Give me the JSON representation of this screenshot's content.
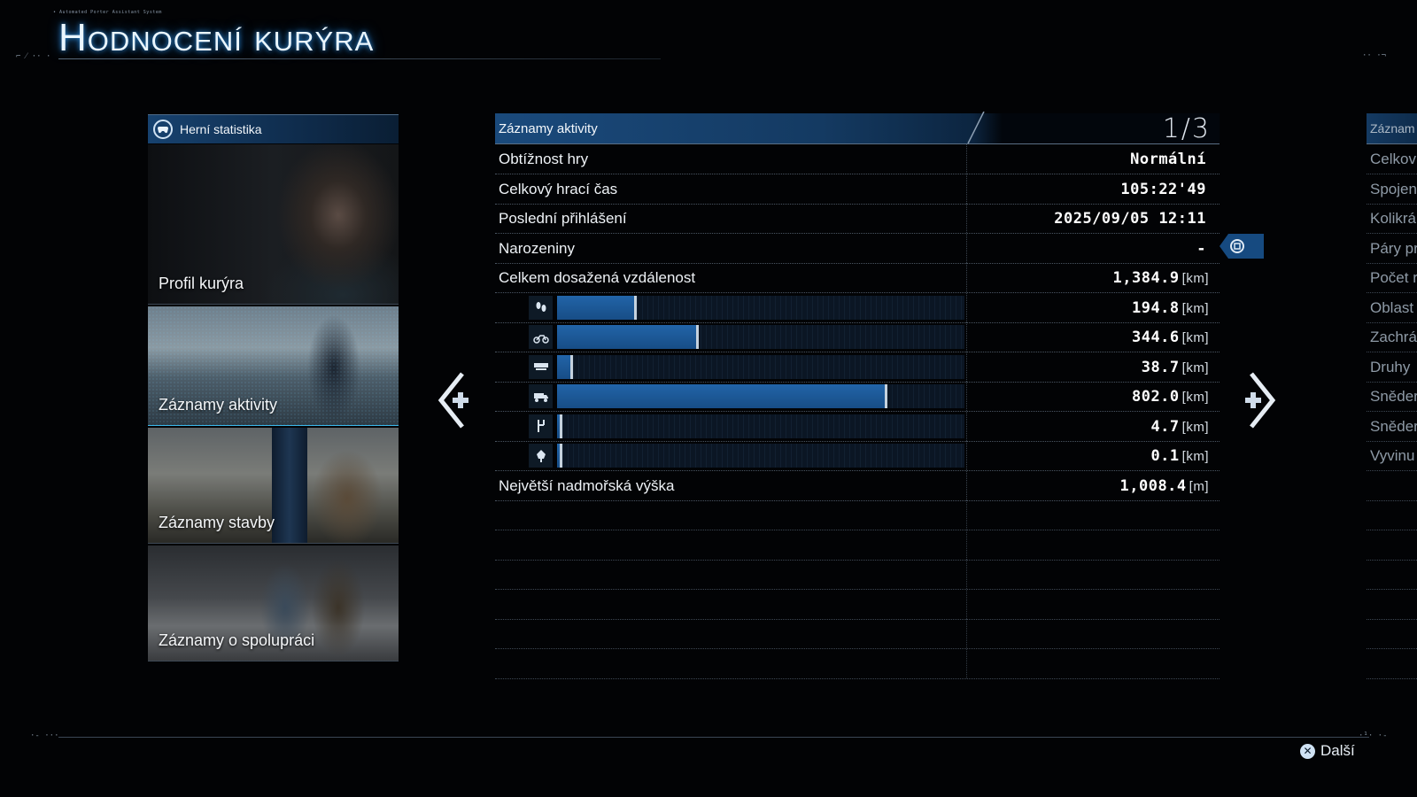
{
  "header": {
    "system_caption": "• Automated Porter Assistant System",
    "title": "Hodnocení kurýra"
  },
  "left_panel": {
    "header_label": "Herní statistika",
    "header_icon": "gamepad-icon",
    "cards": [
      {
        "label": "Profil kurýra",
        "selected": false
      },
      {
        "label": "Záznamy aktivity",
        "selected": true
      },
      {
        "label": "Záznamy stavby",
        "selected": false
      },
      {
        "label": "Záznamy o spolupráci",
        "selected": false
      }
    ]
  },
  "table": {
    "header_label": "Záznamy aktivity",
    "page_indicator": "1/3",
    "rows": [
      {
        "key": "Obtížnost hry",
        "value": "Normální",
        "unit": ""
      },
      {
        "key": "Celkový hrací čas",
        "value": "105:22'49",
        "unit": ""
      },
      {
        "key": "Poslední přihlášení",
        "value": "2025/09/05 12:11",
        "unit": ""
      },
      {
        "key": "Narozeniny",
        "value": "-",
        "unit": ""
      },
      {
        "key": "Celkem dosažená vzdálenost",
        "value": "1,384.9",
        "unit": "[km]"
      }
    ],
    "distance_breakdown": [
      {
        "icon": "footsteps-icon",
        "value": "194.8",
        "unit": "[km]",
        "fraction": 0.196
      },
      {
        "icon": "motorbike-icon",
        "value": "344.6",
        "unit": "[km]",
        "fraction": 0.348
      },
      {
        "icon": "floating-carrier-icon",
        "value": "38.7",
        "unit": "[km]",
        "fraction": 0.04
      },
      {
        "icon": "truck-icon",
        "value": "802.0",
        "unit": "[km]",
        "fraction": 0.81
      },
      {
        "icon": "zipline-icon",
        "value": "4.7",
        "unit": "[km]",
        "fraction": 0.008
      },
      {
        "icon": "jetpack-icon",
        "value": "0.1",
        "unit": "[km]",
        "fraction": 0.003
      }
    ],
    "last_row": {
      "key": "Největší nadmořská výška",
      "value": "1,008.4",
      "unit": "[m]"
    }
  },
  "right_peek": {
    "header_label": "Záznam",
    "rows": [
      "Celkov",
      "Spojen",
      "Kolikrá",
      "Páry pr",
      "Počet r",
      "Oblast",
      "Zachrá",
      "Druhy",
      "Sněder",
      "Sněder",
      "Vyvinu"
    ]
  },
  "footer": {
    "next_label": "Další",
    "next_icon": "cross-button-icon"
  },
  "colors": {
    "accent": "#1f5c99",
    "selection": "#3bb7ea",
    "background": "#020305"
  }
}
